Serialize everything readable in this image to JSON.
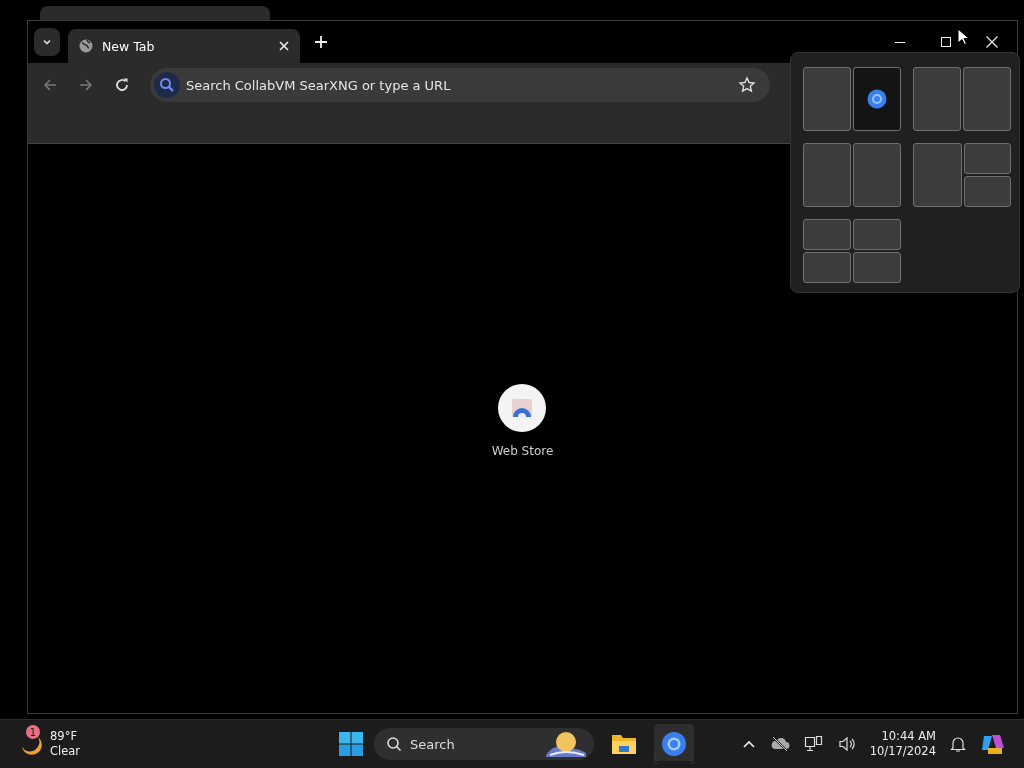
{
  "browser": {
    "tabs": [
      {
        "title": "New Tab",
        "selected": true
      }
    ],
    "nav": [
      {
        "kind": "back",
        "disabled": true
      },
      {
        "kind": "forward",
        "disabled": true
      },
      {
        "kind": "reload",
        "disabled": false
      }
    ],
    "address_bar": {
      "placeholder": "Search CollabVM SearXNG or type a URL"
    },
    "shortcuts": [
      {
        "label": "Web Store"
      }
    ]
  },
  "snap_layouts": [
    {
      "kind": "columns",
      "zones": [
        {
          "selected": false
        },
        {
          "selected": true
        }
      ]
    },
    {
      "kind": "columns",
      "zones": [
        {
          "selected": false
        },
        {
          "selected": false
        }
      ]
    },
    {
      "kind": "columns",
      "zones": [
        {
          "selected": false
        },
        {
          "selected": false
        }
      ]
    },
    {
      "kind": "column-stack",
      "zones": [
        {
          "selected": false
        },
        {
          "selected": false
        },
        {
          "selected": false
        }
      ]
    },
    {
      "kind": "grid",
      "zones": [
        {
          "selected": false
        },
        {
          "selected": false
        },
        {
          "selected": false
        },
        {
          "selected": false
        }
      ]
    }
  ],
  "taskbar": {
    "weather": {
      "badge": "1",
      "temperature": "89°F",
      "condition": "Clear"
    },
    "search": {
      "placeholder": "Search"
    },
    "apps": [
      {
        "kind": "files",
        "active": false
      },
      {
        "kind": "browser",
        "active": true
      }
    ],
    "clock": {
      "time": "10:44 AM",
      "date": "10/17/2024"
    }
  }
}
